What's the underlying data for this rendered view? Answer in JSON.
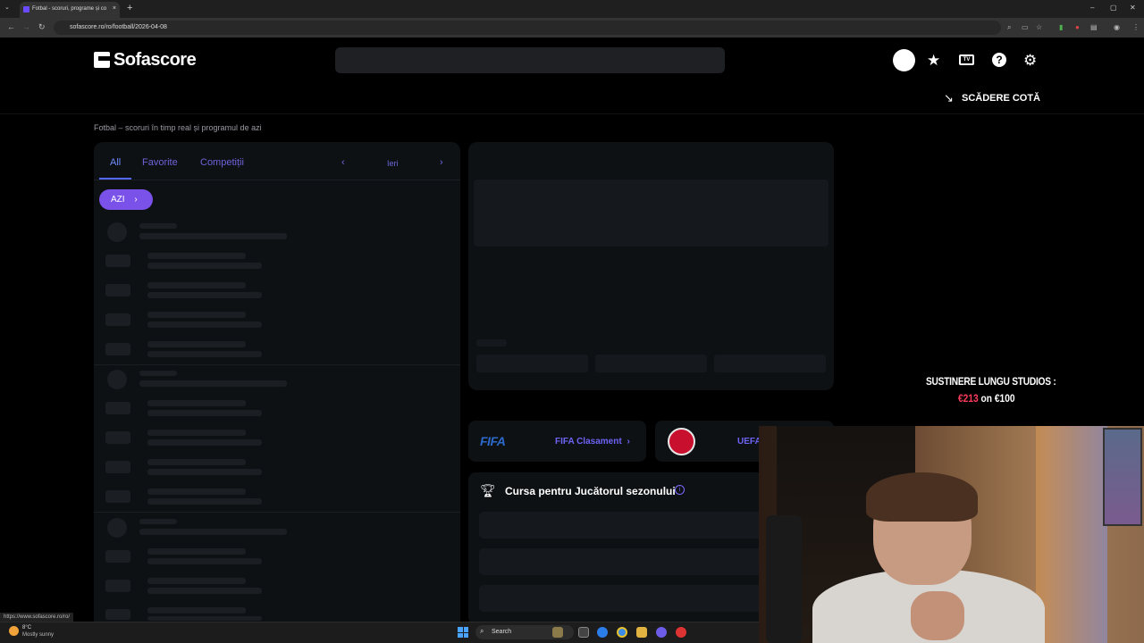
{
  "browser": {
    "tab_title": "Fotbal - scoruri, programe și co",
    "url": "sofascore.ro/ro/football/2026-04-08",
    "new_tab": "+",
    "tab_close": "×",
    "tab_menu": "⌄",
    "min": "–",
    "max": "▢",
    "close": "✕"
  },
  "header": {
    "logo": "Sofascore",
    "tv_label": "TV",
    "help_label": "?",
    "odds_drop_label": "SCĂDERE COTĂ"
  },
  "page_title": "Fotbal – scoruri în timp real și programul de azi",
  "events_panel": {
    "tabs": [
      "All",
      "Favorite",
      "Competiții"
    ],
    "date_prev": "‹",
    "date_label": "Ieri",
    "date_next": "›",
    "today_button": "AZI",
    "today_chevron": "›"
  },
  "links": {
    "fifa_logo": "FIFA",
    "fifa_link": "FIFA Clasament",
    "fifa_chevron": "›",
    "uefa_logo": "UEFA",
    "uefa_link": "UEFA"
  },
  "player_race": {
    "title": "Cursa pentru Jucătorul sezonului",
    "info": "i"
  },
  "donation": {
    "title": "SUSTINERE LUNGU STUDIOS :",
    "current": "€213",
    "separator": "on",
    "goal": "€100"
  },
  "status_url": "https://www.sofascore.ro/ro/",
  "taskbar": {
    "temperature": "8°C",
    "weather": "Mostly sunny",
    "search": "Search"
  },
  "colors": {
    "accent": "#7a52ea",
    "tab_active": "#6d8cff",
    "link": "#6d63f5",
    "donation_red": "#ff3b5c"
  }
}
